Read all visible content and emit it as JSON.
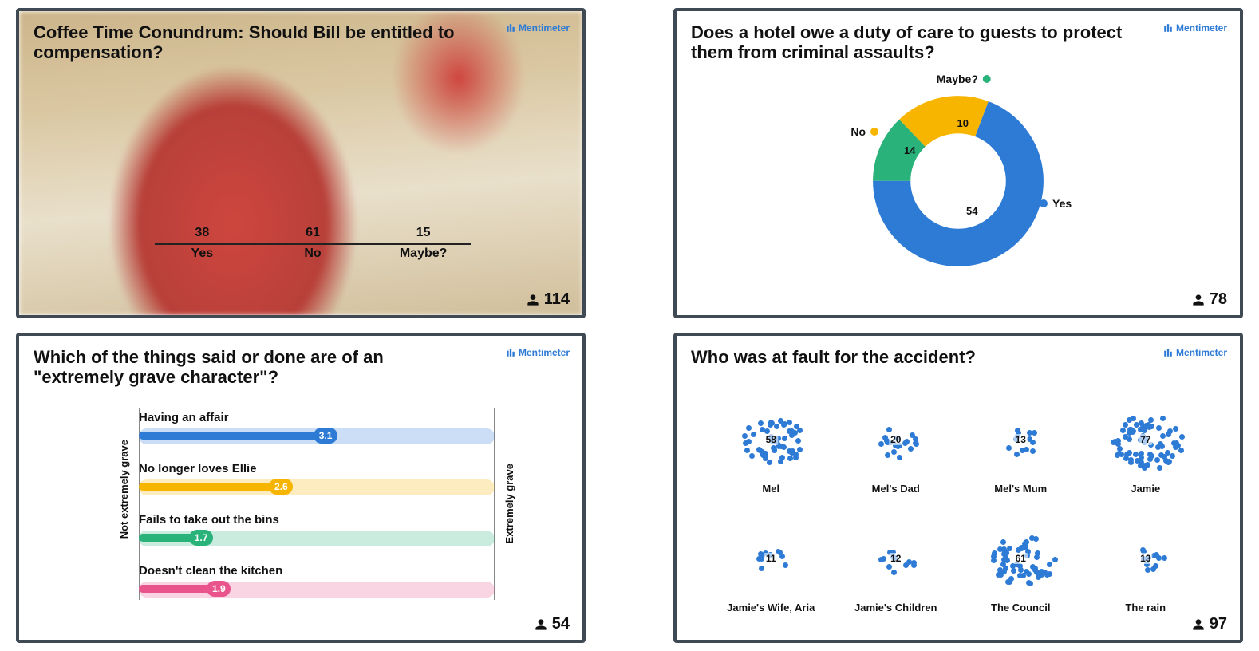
{
  "brand": "Mentimeter",
  "colors": {
    "blue": "#2e7bd6",
    "yellow": "#f7b500",
    "green": "#2ab27b",
    "pink": "#e9548c",
    "dark": "#404a55"
  },
  "slides": {
    "coffee": {
      "title": "Coffee Time Conundrum: Should Bill be entitled to compensation?",
      "respondents": 114
    },
    "hotel": {
      "title": "Does a hotel owe a duty of care to guests to protect them from criminal assaults?",
      "respondents": 78
    },
    "grave": {
      "title": "Which of the things said or done are of an \"extremely grave character\"?",
      "respondents": 54,
      "left_label": "Not extremely grave",
      "right_label": "Extremely grave"
    },
    "fault": {
      "title": "Who was at fault for the accident?",
      "respondents": 97
    }
  },
  "chart_data": [
    {
      "id": "coffee",
      "type": "bar",
      "title": "Coffee Time Conundrum: Should Bill be entitled to compensation?",
      "categories": [
        "Yes",
        "No",
        "Maybe?"
      ],
      "values": [
        38,
        61,
        15
      ],
      "colors": [
        "#2e7bd6",
        "#f7b500",
        "#2ab27b"
      ],
      "ylim": [
        0,
        65
      ],
      "respondents": 114
    },
    {
      "id": "hotel",
      "type": "pie",
      "title": "Does a hotel owe a duty of care to guests to protect them from criminal assaults?",
      "categories": [
        "Yes",
        "No",
        "Maybe?"
      ],
      "values": [
        54,
        14,
        10
      ],
      "colors": [
        "#2e7bd6",
        "#f7b500",
        "#2ab27b"
      ],
      "donut": true,
      "respondents": 78
    },
    {
      "id": "grave",
      "type": "bar",
      "orientation": "horizontal_scale",
      "title": "Which of the things said or done are of an \"extremely grave character\"?",
      "xlabel_left": "Not extremely grave",
      "xlabel_right": "Extremely grave",
      "xlim": [
        1,
        5
      ],
      "series": [
        {
          "name": "Having an affair",
          "value": 3.1,
          "color": "#2e7bd6"
        },
        {
          "name": "No longer loves Ellie",
          "value": 2.6,
          "color": "#f7b500"
        },
        {
          "name": "Fails to take out the bins",
          "value": 1.7,
          "color": "#2ab27b"
        },
        {
          "name": "Doesn't clean the kitchen",
          "value": 1.9,
          "color": "#e9548c"
        }
      ],
      "respondents": 54
    },
    {
      "id": "fault",
      "type": "scatter",
      "subtype": "dot_cluster",
      "title": "Who was at fault for the accident?",
      "categories": [
        "Mel",
        "Mel's Dad",
        "Mel's Mum",
        "Jamie",
        "Jamie's Wife, Aria",
        "Jamie's Children",
        "The Council",
        "The rain"
      ],
      "values": [
        58,
        20,
        13,
        77,
        11,
        12,
        61,
        13
      ],
      "color": "#2e7bd6",
      "respondents": 97
    }
  ]
}
